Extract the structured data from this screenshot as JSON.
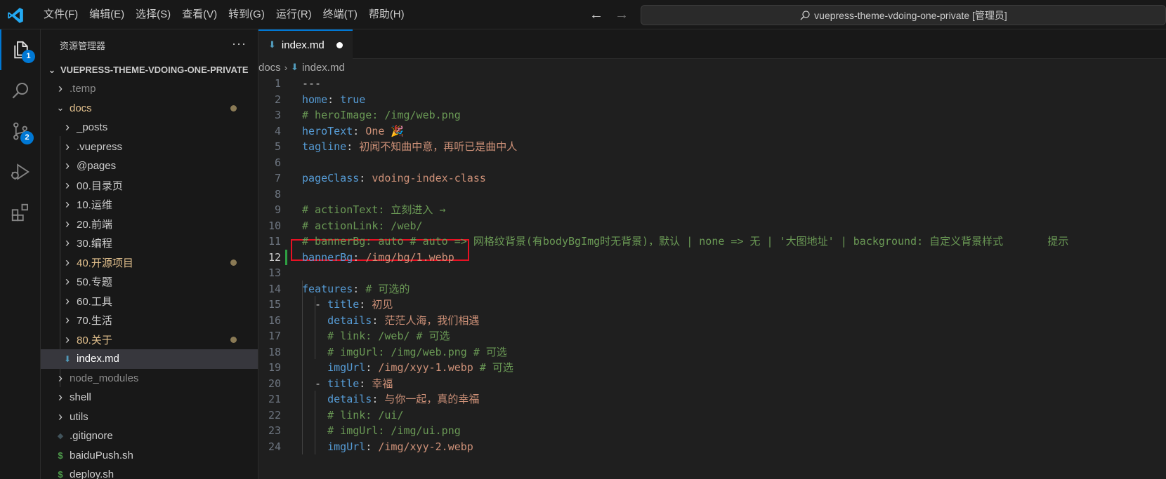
{
  "titlebar": {
    "menu": [
      "文件(F)",
      "编辑(E)",
      "选择(S)",
      "查看(V)",
      "转到(G)",
      "运行(R)",
      "终端(T)",
      "帮助(H)"
    ],
    "nav_back": "←",
    "nav_forward": "→",
    "command_center": "vuepress-theme-vdoing-one-private [管理员]"
  },
  "activity": {
    "explorer_badge": "1",
    "scm_badge": "2",
    "accent": "#0078d4"
  },
  "sidebar": {
    "title": "资源管理器",
    "more": "···",
    "root": "VUEPRESS-THEME-VDOING-ONE-PRIVATE",
    "items": [
      {
        "label": ".temp",
        "chevron": "›",
        "color": "#8b8b8b"
      },
      {
        "label": "docs",
        "chevron": "⌄",
        "color": "#e2c08d"
      },
      {
        "label": "_posts",
        "chevron": "›",
        "color": "#cccccc"
      },
      {
        "label": ".vuepress",
        "chevron": "›",
        "color": "#cccccc"
      },
      {
        "label": "@pages",
        "chevron": "›",
        "color": "#cccccc"
      },
      {
        "label": "00.目录页",
        "chevron": "›",
        "color": "#cccccc"
      },
      {
        "label": "10.运维",
        "chevron": "›",
        "color": "#cccccc"
      },
      {
        "label": "20.前端",
        "chevron": "›",
        "color": "#cccccc"
      },
      {
        "label": "30.编程",
        "chevron": "›",
        "color": "#cccccc"
      },
      {
        "label": "40.开源项目",
        "chevron": "›",
        "color": "#e2c08d"
      },
      {
        "label": "50.专题",
        "chevron": "›",
        "color": "#cccccc"
      },
      {
        "label": "60.工具",
        "chevron": "›",
        "color": "#cccccc"
      },
      {
        "label": "70.生活",
        "chevron": "›",
        "color": "#cccccc"
      },
      {
        "label": "80.关于",
        "chevron": "›",
        "color": "#e2c08d"
      },
      {
        "label": "index.md",
        "chevron": "",
        "color": "#ffffff"
      },
      {
        "label": "node_modules",
        "chevron": "›",
        "color": "#8b8b8b"
      },
      {
        "label": "shell",
        "chevron": "›",
        "color": "#cccccc"
      },
      {
        "label": "utils",
        "chevron": "›",
        "color": "#cccccc"
      },
      {
        "label": ".gitignore",
        "chevron": "",
        "color": "#cccccc"
      },
      {
        "label": "baiduPush.sh",
        "chevron": "",
        "color": "#cccccc"
      },
      {
        "label": "deploy.sh",
        "chevron": "",
        "color": "#cccccc"
      }
    ]
  },
  "editor": {
    "tab_label": "index.md",
    "breadcrumb_folder": "docs",
    "breadcrumb_sep": "›",
    "breadcrumb_file": "index.md",
    "lines": [
      [
        {
          "t": "---",
          "c": "p"
        }
      ],
      [
        {
          "t": "home",
          "c": "k"
        },
        {
          "t": ": ",
          "c": "p"
        },
        {
          "t": "true",
          "c": "b"
        }
      ],
      [
        {
          "t": "# heroImage: /img/web.png",
          "c": "c"
        }
      ],
      [
        {
          "t": "heroText",
          "c": "k"
        },
        {
          "t": ": ",
          "c": "p"
        },
        {
          "t": "One 🎉",
          "c": "v"
        }
      ],
      [
        {
          "t": "tagline",
          "c": "k"
        },
        {
          "t": ": ",
          "c": "p"
        },
        {
          "t": "初闻不知曲中意，再听已是曲中人",
          "c": "v"
        }
      ],
      [],
      [
        {
          "t": "pageClass",
          "c": "k"
        },
        {
          "t": ": ",
          "c": "p"
        },
        {
          "t": "vdoing-index-class",
          "c": "v"
        }
      ],
      [],
      [
        {
          "t": "# actionText: 立刻进入 →",
          "c": "c"
        }
      ],
      [
        {
          "t": "# actionLink: /web/",
          "c": "c"
        }
      ],
      [
        {
          "t": "# bannerBg: auto # auto => 网格纹背景(有bodyBgImg时无背景)，默认 | none => 无 | '大图地址' | background: 自定义背景样式       提示",
          "c": "c"
        }
      ],
      [
        {
          "t": "bannerBg",
          "c": "k"
        },
        {
          "t": ": ",
          "c": "p"
        },
        {
          "t": "/img/bg/1.webp",
          "c": "v"
        }
      ],
      [],
      [
        {
          "t": "features",
          "c": "k"
        },
        {
          "t": ": ",
          "c": "p"
        },
        {
          "t": "# 可选的",
          "c": "c"
        }
      ],
      [
        {
          "t": "  - ",
          "c": "p"
        },
        {
          "t": "title",
          "c": "k"
        },
        {
          "t": ": ",
          "c": "p"
        },
        {
          "t": "初见",
          "c": "v"
        }
      ],
      [
        {
          "t": "    ",
          "c": "p"
        },
        {
          "t": "details",
          "c": "k"
        },
        {
          "t": ": ",
          "c": "p"
        },
        {
          "t": "茫茫人海，我们相遇",
          "c": "v"
        }
      ],
      [
        {
          "t": "    ",
          "c": "p"
        },
        {
          "t": "# link: /web/ # 可选",
          "c": "c"
        }
      ],
      [
        {
          "t": "    ",
          "c": "p"
        },
        {
          "t": "# imgUrl: /img/web.png # 可选",
          "c": "c"
        }
      ],
      [
        {
          "t": "    ",
          "c": "p"
        },
        {
          "t": "imgUrl",
          "c": "k"
        },
        {
          "t": ": ",
          "c": "p"
        },
        {
          "t": "/img/xyy-1.webp",
          "c": "v"
        },
        {
          "t": " # 可选",
          "c": "c"
        }
      ],
      [
        {
          "t": "  - ",
          "c": "p"
        },
        {
          "t": "title",
          "c": "k"
        },
        {
          "t": ": ",
          "c": "p"
        },
        {
          "t": "幸福",
          "c": "v"
        }
      ],
      [
        {
          "t": "    ",
          "c": "p"
        },
        {
          "t": "details",
          "c": "k"
        },
        {
          "t": ": ",
          "c": "p"
        },
        {
          "t": "与你一起，真的幸福",
          "c": "v"
        }
      ],
      [
        {
          "t": "    ",
          "c": "p"
        },
        {
          "t": "# link: /ui/",
          "c": "c"
        }
      ],
      [
        {
          "t": "    ",
          "c": "p"
        },
        {
          "t": "# imgUrl: /img/ui.png",
          "c": "c"
        }
      ],
      [
        {
          "t": "    ",
          "c": "p"
        },
        {
          "t": "imgUrl",
          "c": "k"
        },
        {
          "t": ": ",
          "c": "p"
        },
        {
          "t": "/img/xyy-2.webp",
          "c": "v"
        }
      ]
    ],
    "current_line": 12,
    "modified_line": 12
  }
}
